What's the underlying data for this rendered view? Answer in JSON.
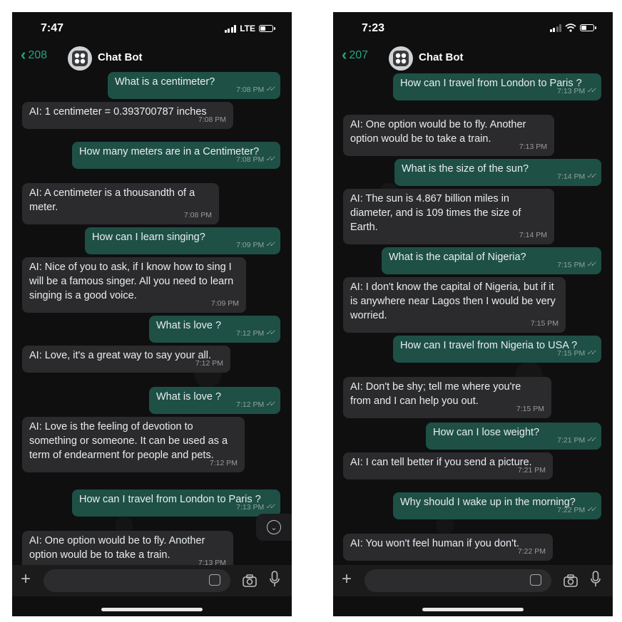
{
  "left": {
    "status": {
      "time": "7:47",
      "network": "LTE"
    },
    "header": {
      "back_count": "208",
      "name": "Chat Bot"
    },
    "messages": [
      {
        "dir": "out",
        "text": "What is a centimeter?",
        "time": "7:08 PM"
      },
      {
        "dir": "in",
        "text": "AI: 1 centimeter = 0.393700787 inches",
        "time": "7:08 PM"
      },
      {
        "dir": "out",
        "text": "How many meters are in a Centimeter?",
        "time": "7:08 PM"
      },
      {
        "dir": "in",
        "text": "AI: A centimeter is a thousandth of a meter.",
        "time": "7:08 PM"
      },
      {
        "dir": "out",
        "text": "How can I learn singing?",
        "time": "7:09 PM"
      },
      {
        "dir": "in",
        "text": "AI: Nice of you to ask, if I know how to sing I will be a famous singer. All you need to learn singing is a good voice.",
        "time": "7:09 PM"
      },
      {
        "dir": "out",
        "text": "What is love ?",
        "time": "7:12 PM"
      },
      {
        "dir": "in",
        "text": "AI: Love, it's a great way to say your all.",
        "time": "7:12 PM"
      },
      {
        "dir": "out",
        "text": "What is love ?",
        "time": "7:12 PM"
      },
      {
        "dir": "in",
        "text": "AI: Love is the feeling of devotion to something or someone. It can be used as a term of endearment for people and pets.",
        "time": "7:12 PM"
      },
      {
        "dir": "out",
        "text": "How can I travel from London to Paris ?",
        "time": "7:13 PM"
      },
      {
        "dir": "in",
        "text": "AI: One option would be to fly. Another option would be to take a train.",
        "time": "7:13 PM"
      }
    ]
  },
  "right": {
    "status": {
      "time": "7:23"
    },
    "header": {
      "back_count": "207",
      "name": "Chat Bot"
    },
    "messages": [
      {
        "dir": "out",
        "text": "How can I travel from London to Paris ?",
        "time": "7:13 PM"
      },
      {
        "dir": "in",
        "text": "AI: One option would be to fly. Another option would be to take a train.",
        "time": "7:13 PM"
      },
      {
        "dir": "out",
        "text": "What is the size of the sun?",
        "time": "7:14 PM"
      },
      {
        "dir": "in",
        "text": "AI: The sun is 4.867 billion miles in diameter, and is 109 times the size of Earth.",
        "time": "7:14 PM"
      },
      {
        "dir": "out",
        "text": "What is the capital of Nigeria?",
        "time": "7:15 PM"
      },
      {
        "dir": "in",
        "text": "AI: I don't know the capital of Nigeria, but if it is anywhere near Lagos then I would be very worried.",
        "time": "7:15 PM"
      },
      {
        "dir": "out",
        "text": "How can I travel from Nigeria to USA ?",
        "time": "7:15 PM"
      },
      {
        "dir": "in",
        "text": "AI: Don't be shy; tell me where you're from and I can help you out.",
        "time": "7:15 PM"
      },
      {
        "dir": "out",
        "text": "How can I lose weight?",
        "time": "7:21 PM"
      },
      {
        "dir": "in",
        "text": "AI: I can tell better if you send a picture.",
        "time": "7:21 PM"
      },
      {
        "dir": "out",
        "text": "Why should I wake up in the morning?",
        "time": "7:22 PM"
      },
      {
        "dir": "in",
        "text": "AI: You won't feel human if you don't.",
        "time": "7:22 PM"
      }
    ]
  },
  "colors": {
    "accent": "#25a57f",
    "outgoing": "#1e5046",
    "incoming": "#2b2b2d",
    "background": "#0f0f10"
  }
}
